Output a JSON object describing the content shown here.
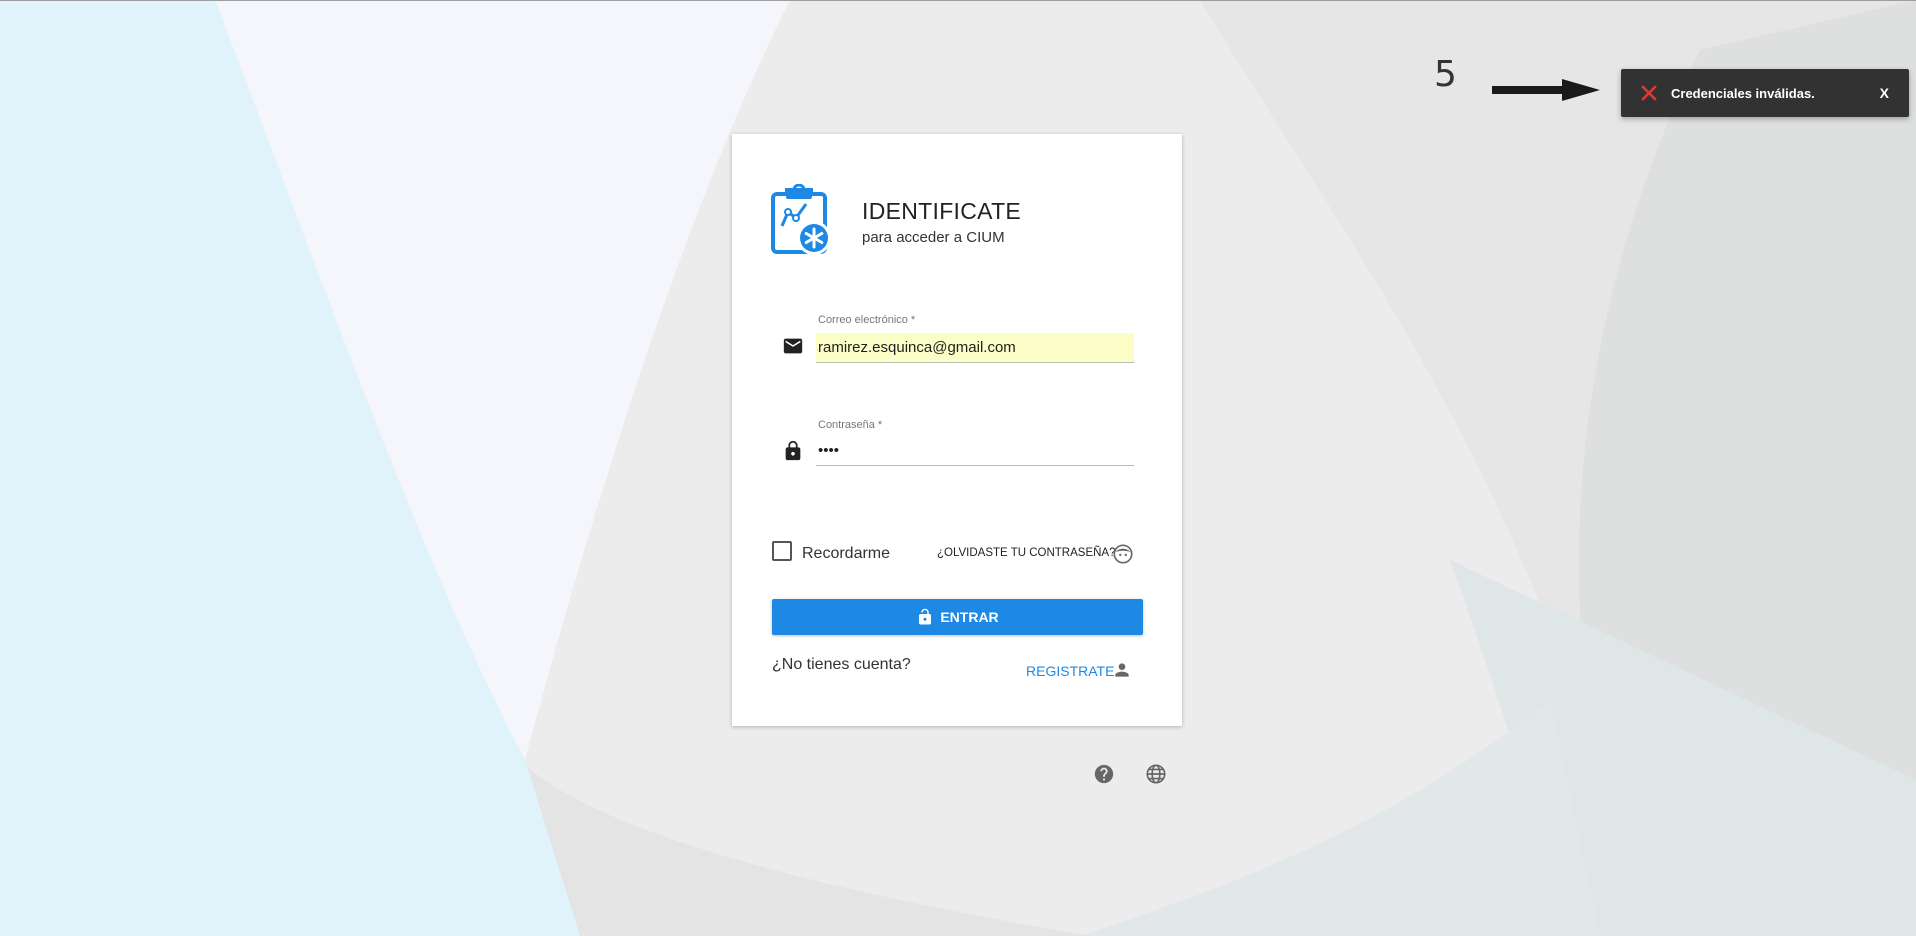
{
  "annotation": {
    "number": "5"
  },
  "toast": {
    "icon": "error-x-icon",
    "icon_color": "#e53935",
    "message": "Credenciales inválidas.",
    "close_label": "X"
  },
  "login": {
    "title": "IDENTIFICATE",
    "subtitle": "para acceder a CIUM",
    "logo_icon": "clipboard-medical-icon",
    "accent_color": "#1e88e5",
    "email": {
      "label": "Correo electrónico *",
      "value": "ramirez.esquinca@gmail.com",
      "icon": "email-icon"
    },
    "password": {
      "label": "Contraseña *",
      "value": "••••",
      "icon": "lock-icon"
    },
    "remember_label": "Recordarme",
    "forgot_label": "¿OLVIDASTE TU CONTRASEÑA?",
    "enter_label": "ENTRAR",
    "no_account_label": "¿No tienes cuenta?",
    "register_label": "REGISTRATE"
  },
  "footer": {
    "help_icon": "help-icon",
    "language_icon": "globe-icon"
  }
}
